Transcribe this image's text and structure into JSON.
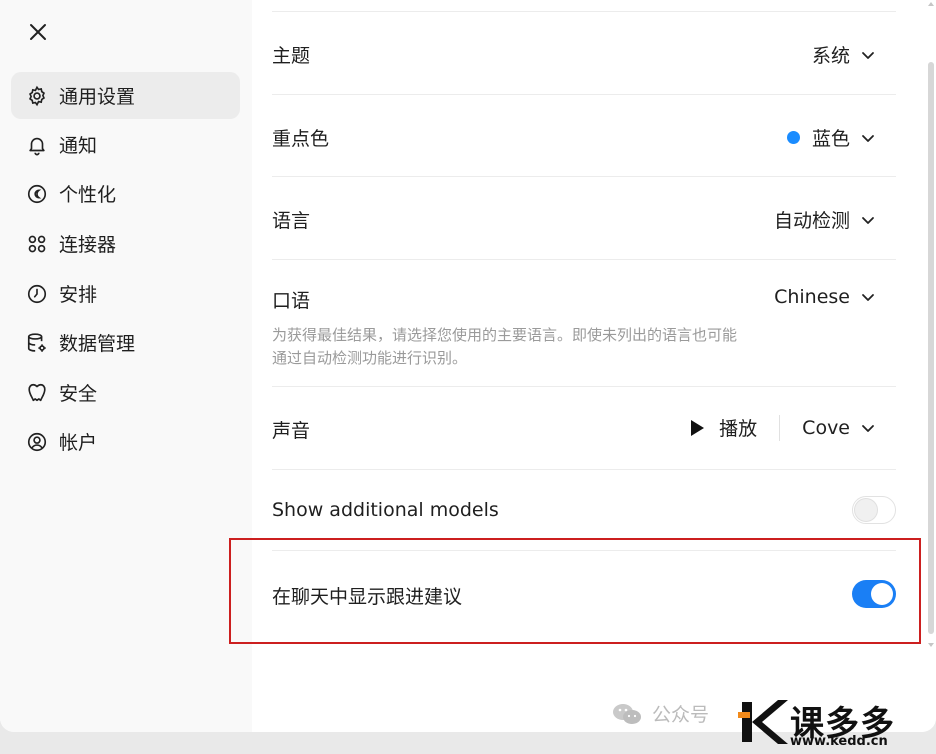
{
  "sidebar": {
    "close_label": "",
    "items": [
      {
        "label": "通用设置",
        "icon": "gear-icon",
        "active": true
      },
      {
        "label": "通知",
        "icon": "bell-icon"
      },
      {
        "label": "个性化",
        "icon": "personalize-icon"
      },
      {
        "label": "连接器",
        "icon": "connectors-icon"
      },
      {
        "label": "安排",
        "icon": "clock-icon"
      },
      {
        "label": "数据管理",
        "icon": "database-gear-icon"
      },
      {
        "label": "安全",
        "icon": "shield-icon"
      },
      {
        "label": "帐户",
        "icon": "user-circle-icon"
      }
    ]
  },
  "settings": {
    "theme": {
      "label": "主题",
      "value": "系统"
    },
    "accent": {
      "label": "重点色",
      "value": "蓝色",
      "color": "#1a8cff"
    },
    "language": {
      "label": "语言",
      "value": "自动检测"
    },
    "spoken": {
      "label": "口语",
      "value": "Chinese",
      "help_line1": "为获得最佳结果，请选择您使用的主要语言。即使未列出的语言也可能",
      "help_line2": "通过自动检测功能进行识别。"
    },
    "voice": {
      "label": "声音",
      "play_label": "播放",
      "value": "Cove"
    },
    "additional_models": {
      "label": "Show additional models",
      "enabled": false
    },
    "follow_up": {
      "label": "在聊天中显示跟进建议",
      "enabled": true,
      "color": "#1a7ff5"
    }
  },
  "highlight_color": "#cc1f1f",
  "watermark": {
    "text": "公众号",
    "brand": "课多多",
    "url": "www.kedd.cn"
  }
}
